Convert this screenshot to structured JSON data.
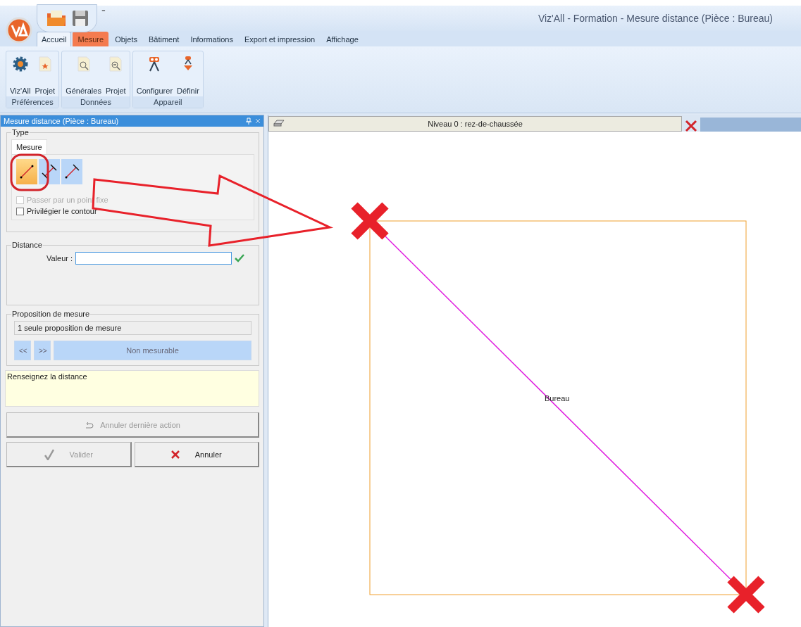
{
  "window": {
    "title": "Viz'All - Formation - Mesure distance (Pièce : Bureau)",
    "quick_access": "⁼"
  },
  "ribbon_tabs": [
    {
      "label": "Accueil",
      "selected": true,
      "kind": "normal"
    },
    {
      "label": "Mesure",
      "selected": false,
      "kind": "contextual"
    },
    {
      "label": "Objets",
      "selected": false,
      "kind": "normal"
    },
    {
      "label": "Bâtiment",
      "selected": false,
      "kind": "normal"
    },
    {
      "label": "Informations",
      "selected": false,
      "kind": "normal"
    },
    {
      "label": "Export et impression",
      "selected": false,
      "kind": "normal"
    },
    {
      "label": "Affichage",
      "selected": false,
      "kind": "normal"
    }
  ],
  "ribbon_groups": [
    {
      "label": "Préférences",
      "buttons": [
        {
          "label": "Viz'All",
          "kind": "gear"
        },
        {
          "label": "Projet",
          "kind": "star-doc"
        }
      ]
    },
    {
      "label": "Données",
      "buttons": [
        {
          "label": "Générales",
          "kind": "info-doc"
        },
        {
          "label": "Projet",
          "kind": "zoom-doc"
        }
      ]
    },
    {
      "label": "Appareil",
      "buttons": [
        {
          "label": "Configurer",
          "kind": "device"
        },
        {
          "label": "Définir",
          "kind": "device-drop"
        }
      ]
    }
  ],
  "panel": {
    "title": "Mesure distance (Pièce : Bureau)",
    "type_group": {
      "legend": "Type",
      "tab": "Mesure",
      "tools": [
        {
          "kind": "segment",
          "selected": true
        },
        {
          "kind": "perpendicular-both",
          "selected": false
        },
        {
          "kind": "perpendicular-end",
          "selected": false
        }
      ],
      "options": [
        {
          "label": "Passer par un point fixe",
          "checked": false,
          "disabled": true
        },
        {
          "label": "Privilégier le contour",
          "checked": false,
          "disabled": false
        }
      ]
    },
    "distance": {
      "legend": "Distance",
      "label": "Valeur :"
    },
    "proposition": {
      "legend": "Proposition de mesure",
      "text": "1 seule proposition de mesure",
      "prev": "<<",
      "next": ">>",
      "result": "Non mesurable"
    },
    "message": "Renseignez la distance",
    "undo_button": {
      "label": "Annuler dernière action",
      "disabled": true
    },
    "buttons": [
      {
        "label": "Valider",
        "kind": "validate",
        "disabled": true
      },
      {
        "label": "Annuler",
        "kind": "cancel",
        "disabled": false
      }
    ]
  },
  "canvas": {
    "tab": "Niveau 0 : rez-de-chaussée",
    "room_label": "Bureau"
  }
}
